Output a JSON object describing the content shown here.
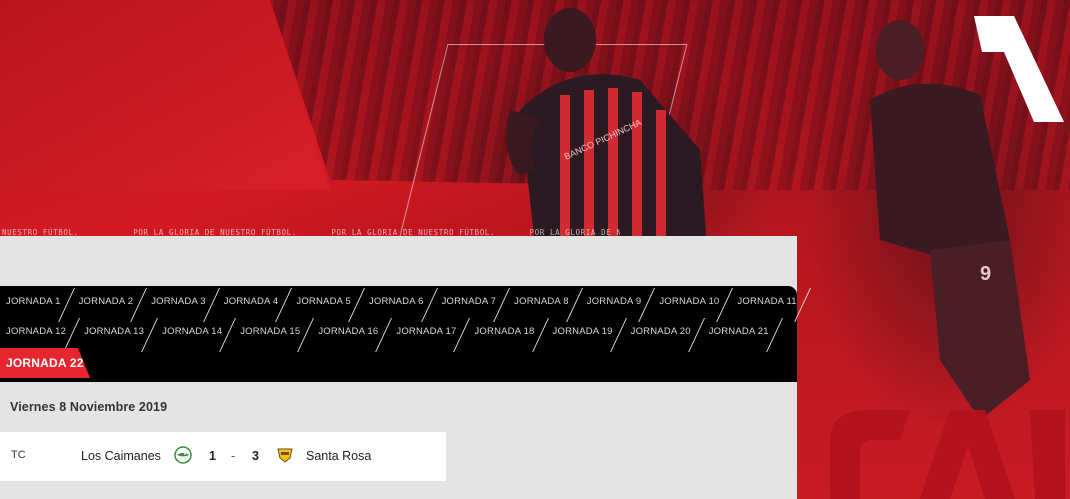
{
  "marquee": {
    "items": [
      "NUESTRO FÚTBOL.",
      "POR LA GLORIA DE NUESTRO FÚTBOL.",
      "POR LA GLORIA DE NUESTRO FÚTBOL.",
      "POR LA GLORIA DE NUESTRO FÚTBOL."
    ]
  },
  "jornadas": {
    "row1": [
      "JORNADA 1",
      "JORNADA 2",
      "JORNADA 3",
      "JORNADA 4",
      "JORNADA 5",
      "JORNADA 6",
      "JORNADA 7",
      "JORNADA 8",
      "JORNADA 9",
      "JORNADA 10",
      "JORNADA 11"
    ],
    "row2": [
      "JORNADA 12",
      "JORNADA 13",
      "JORNADA 14",
      "JORNADA 15",
      "JORNADA 16",
      "JORNADA 17",
      "JORNADA 18",
      "JORNADA 19",
      "JORNADA 20",
      "JORNADA 21"
    ],
    "active": "JORNADA 22"
  },
  "fixtures": {
    "date": "Viernes 8 Noviembre 2019",
    "match": {
      "code": "TC",
      "home": "Los Caimanes",
      "home_score": "1",
      "separator": "-",
      "away_score": "3",
      "away": "Santa Rosa"
    }
  },
  "colors": {
    "accent": "#e5262f",
    "hero_red": "#c81b24",
    "bar": "#000000",
    "panel": "#e4e4e4"
  },
  "icons": {
    "home_badge": "crocodile-crest-icon",
    "away_badge": "santa-rosa-crest-icon"
  }
}
